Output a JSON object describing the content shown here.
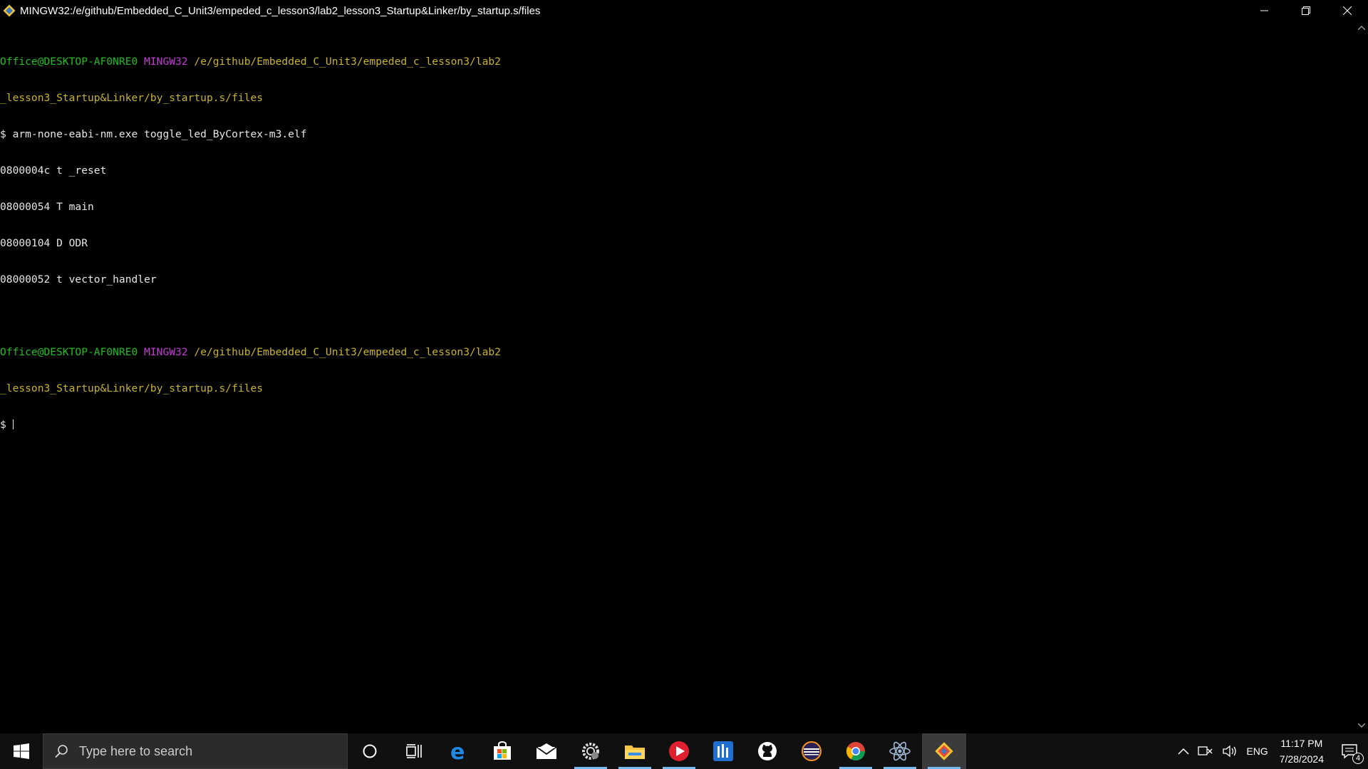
{
  "window": {
    "title": "MINGW32:/e/github/Embedded_C_Unit3/empeded_c_lesson3/lab2_lesson3_Startup&Linker/by_startup.s/files"
  },
  "terminal": {
    "prompt1": {
      "user": "Office@DESKTOP-AF0NRE0",
      "env": "MINGW32",
      "path_line1": "/e/github/Embedded_C_Unit3/empeded_c_lesson3/lab2",
      "path_line2": "_lesson3_Startup&Linker/by_startup.s/files"
    },
    "command": "$ arm-none-eabi-nm.exe toggle_led_ByCortex-m3.elf",
    "output": [
      "0800004c t _reset",
      "08000054 T main",
      "08000104 D ODR",
      "08000052 t vector_handler"
    ],
    "prompt2": {
      "user": "Office@DESKTOP-AF0NRE0",
      "env": "MINGW32",
      "path_line1": "/e/github/Embedded_C_Unit3/empeded_c_lesson3/lab2",
      "path_line2": "_lesson3_Startup&Linker/by_startup.s/files"
    },
    "current_prompt": "$ "
  },
  "taskbar": {
    "search_placeholder": "Type here to search",
    "language": "ENG",
    "time": "11:17 PM",
    "date": "7/28/2024",
    "notification_count": "4",
    "icons": [
      "cortana-icon",
      "task-view-icon",
      "edge-icon",
      "store-icon",
      "mail-icon",
      "settings-gear-icon",
      "file-explorer-icon",
      "media-player-icon",
      "equalizer-app-icon",
      "github-icon",
      "eclipse-icon",
      "chrome-icon",
      "atom-icon",
      "git-bash-icon"
    ]
  },
  "colors": {
    "prompt_user": "#1fbf1f",
    "prompt_env": "#c23bd4",
    "prompt_path": "#c9b32b",
    "text": "#e6e6e6"
  }
}
